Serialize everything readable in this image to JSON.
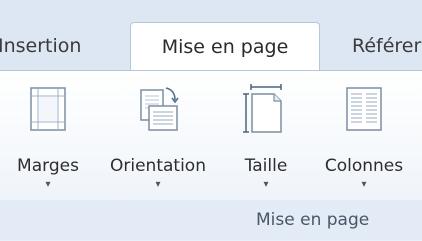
{
  "tabs": [
    {
      "label": "Insertion",
      "active": false
    },
    {
      "label": "Mise en page",
      "active": true
    },
    {
      "label": "Référer",
      "active": false
    }
  ],
  "commands": [
    {
      "label": "Marges",
      "icon": "margins-icon"
    },
    {
      "label": "Orientation",
      "icon": "orientation-icon"
    },
    {
      "label": "Taille",
      "icon": "page-size-icon"
    },
    {
      "label": "Colonnes",
      "icon": "columns-icon"
    }
  ],
  "group": {
    "label": "Mise en page"
  },
  "dropdown_glyph": "▾"
}
